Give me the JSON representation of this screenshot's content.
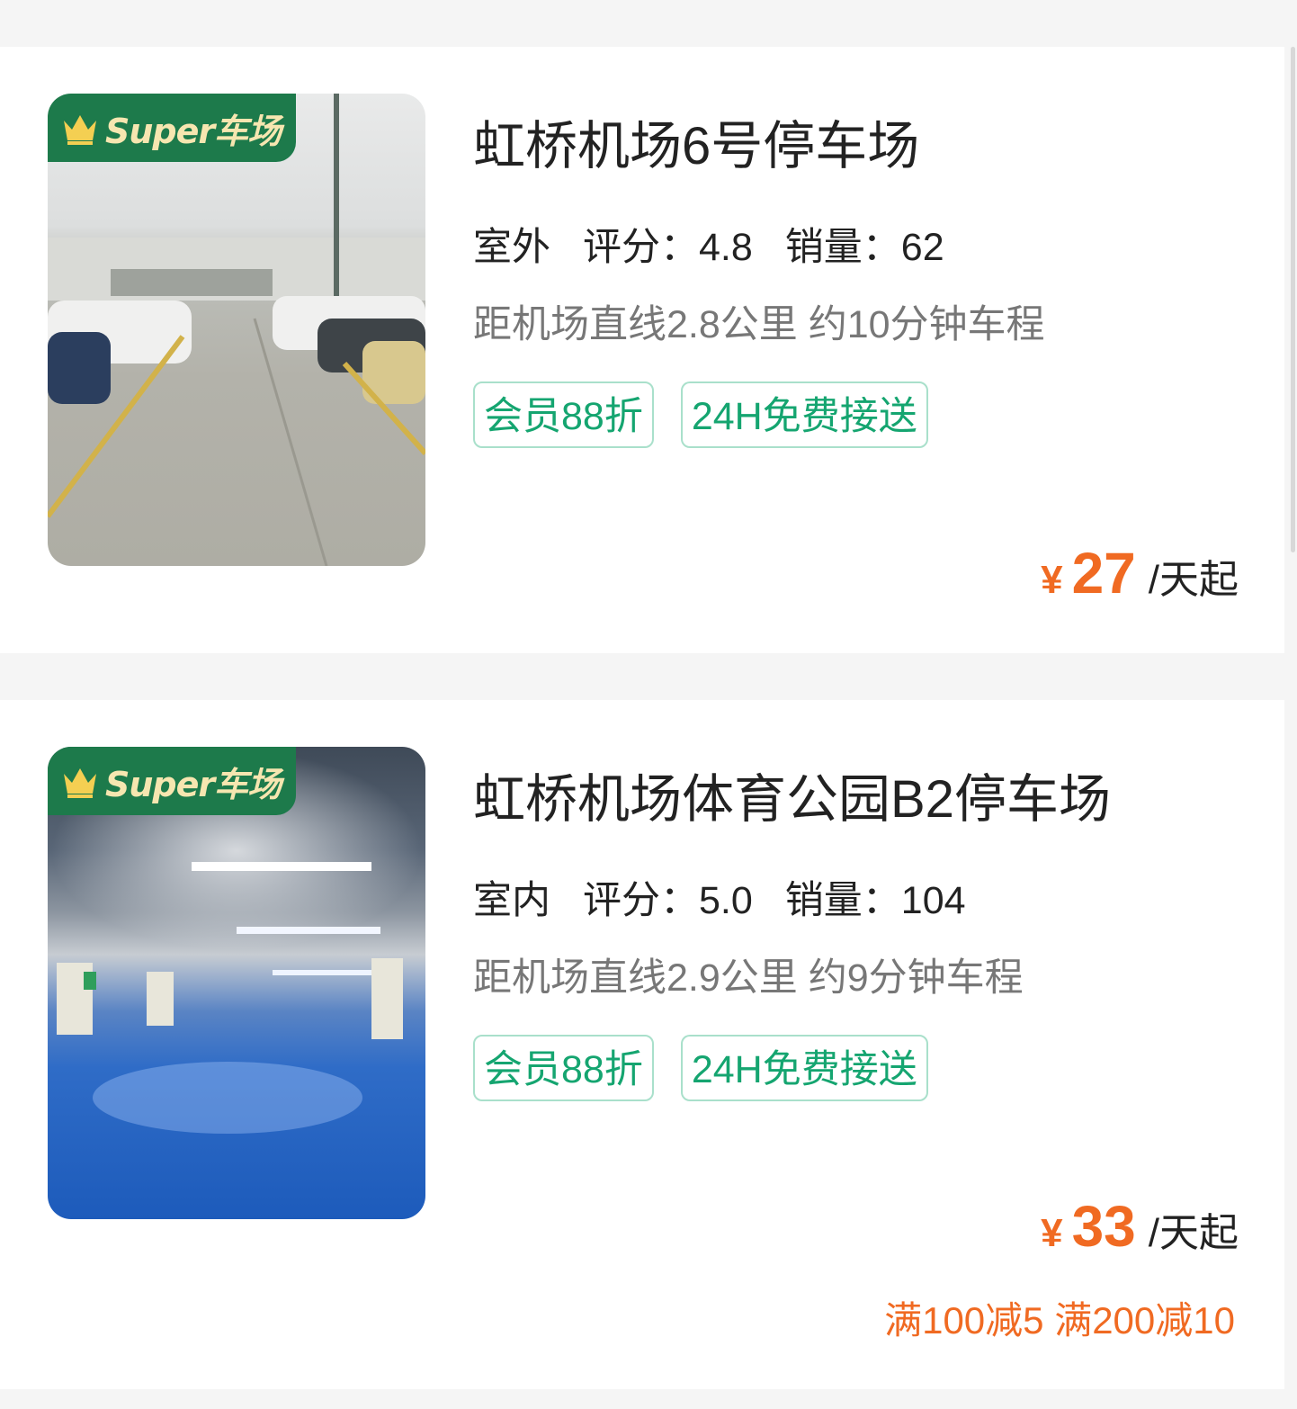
{
  "lots": [
    {
      "badge": "Super车场",
      "name": "虹桥机场6号停车场",
      "type": "室外",
      "rating_label": "评分：",
      "rating": "4.8",
      "sales_label": "销量：",
      "sales": "62",
      "distance": "距机场直线2.8公里 约10分钟车程",
      "tags": [
        "会员88折",
        "24H免费接送"
      ],
      "currency": "¥",
      "price": "27",
      "price_unit": "/天起",
      "promo": ""
    },
    {
      "badge": "Super车场",
      "name": "虹桥机场体育公园B2停车场",
      "type": "室内",
      "rating_label": "评分：",
      "rating": "5.0",
      "sales_label": "销量：",
      "sales": "104",
      "distance": "距机场直线2.9公里 约9分钟车程",
      "tags": [
        "会员88折",
        "24H免费接送"
      ],
      "currency": "¥",
      "price": "33",
      "price_unit": "/天起",
      "promo": "满100减5 满200减10"
    }
  ],
  "colors": {
    "price": "#f06a22",
    "tag": "#15a570",
    "badge_bg": "#1d7a4b"
  }
}
